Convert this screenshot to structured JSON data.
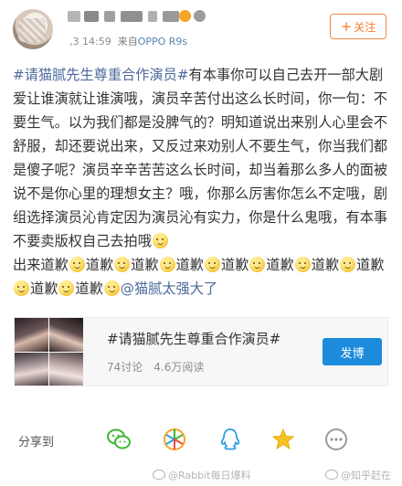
{
  "header": {
    "time": ",3 14:59",
    "source_prefix": "来自",
    "device": "OPPO R9s",
    "follow_label": "关注",
    "follow_icon": "plus-icon"
  },
  "post": {
    "topic": "#请猫腻先生尊重合作演员#",
    "body": "有本事你可以自己去开一部大剧爱让谁演就让谁演哦，演员辛苦付出这么长时间，你一句：不要生气。以为我们都是没脾气的？明知道说出来别人心里会不舒服，却还要说出来，又反过来劝别人不要生气，你当我们都是傻子呢？演员辛辛苦苦这么长时间，却当着那么多人的面被说不是你心里的理想女主？哦，你那么厉害你怎么不定哦，剧组选择演员沁肯定因为演员沁有实力，你是什么鬼哦，有本事不要卖版权自己去拍哦",
    "line_prefix": "出来道歉",
    "apology_word": "道歉",
    "apology_line2_start": "歉",
    "mention": "@猫腻太强大了",
    "emoji_icon": "smile-emoji-icon"
  },
  "topic_card": {
    "title": "#请猫腻先生尊重合作演员#",
    "discussions": "74讨论",
    "reads": "4.6万阅读",
    "post_button": "发博"
  },
  "share": {
    "label": "分享到",
    "targets": [
      "wechat-icon",
      "moments-icon",
      "qq-icon",
      "qzone-icon",
      "more-icon"
    ],
    "colors": {
      "wechat": "#3fb634",
      "moments": "#f5a623",
      "qq": "#2d9fe0",
      "qzone": "#f7c322",
      "more": "#9a9a9a"
    }
  },
  "watermarks": {
    "left": "@Rabbit每日爆料",
    "right": "@知乎赶在"
  },
  "colors": {
    "link": "#4d6a9c",
    "accent": "#f07a2e",
    "button_blue": "#1c8bdc"
  }
}
